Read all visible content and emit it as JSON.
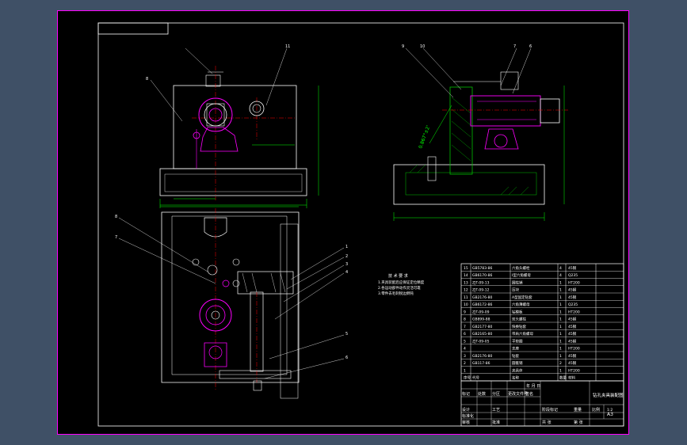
{
  "colors": {
    "viewport": "#3f5066",
    "sheet": "#000000",
    "frame": "#ff00ff",
    "line": "#ffffff",
    "outline": "#00ff00",
    "section": "#ff00ff",
    "dimension": "#00ff00",
    "center": "#ff0000",
    "hatch": "#00c000",
    "table": "#ffffff",
    "leader": "#ffffff"
  },
  "drawing": {
    "balloons_front": [
      "8",
      "11"
    ],
    "balloons_side": [
      "9",
      "10",
      "7",
      "6"
    ],
    "balloons_plan": [
      "8",
      "7",
      "1",
      "2",
      "3",
      "4",
      "5",
      "6"
    ],
    "angle_note": "0.867°±2'",
    "tech_notes": [
      "技 术 要 求",
      "1.夹具装配后应保证定位精度",
      "2.各运动部件动作灵活可靠",
      "3.零件去毛刺锐边倒钝"
    ]
  },
  "bom": {
    "rows": [
      {
        "no": "15",
        "code": "GB5783-86",
        "name": "六角头螺栓",
        "qty": "4",
        "mat": "45钢"
      },
      {
        "no": "14",
        "code": "GB6170-86",
        "name": "I型六角螺母",
        "qty": "4",
        "mat": "Q235"
      },
      {
        "no": "13",
        "code": "ZJT-09-13",
        "name": "圆柱销",
        "qty": "1",
        "mat": "HT200"
      },
      {
        "no": "12",
        "code": "ZJT-09-12",
        "name": "压块",
        "qty": "1",
        "mat": "45钢"
      },
      {
        "no": "11",
        "code": "GB2176-80",
        "name": "A型固定钻套",
        "qty": "1",
        "mat": "45钢"
      },
      {
        "no": "10",
        "code": "GB6172-86",
        "name": "六角薄螺母",
        "qty": "1",
        "mat": "Q235"
      },
      {
        "no": "9",
        "code": "ZJT-09-09",
        "name": "钻模板",
        "qty": "1",
        "mat": "HT200"
      },
      {
        "no": "8",
        "code": "GB899-88",
        "name": "双头螺柱",
        "qty": "1",
        "mat": "45钢"
      },
      {
        "no": "7",
        "code": "GB2177-80",
        "name": "快换钻套",
        "qty": "1",
        "mat": "45钢"
      },
      {
        "no": "6",
        "code": "GB2165-80",
        "name": "带肩六角螺母",
        "qty": "1",
        "mat": "45钢"
      },
      {
        "no": "5",
        "code": "ZJT-09-05",
        "name": "平垫圈",
        "qty": "1",
        "mat": "45钢"
      },
      {
        "no": "4",
        "code": "",
        "name": "支座",
        "qty": "1",
        "mat": "HT200"
      },
      {
        "no": "3",
        "code": "GB2176-80",
        "name": "钻套",
        "qty": "1",
        "mat": "45钢"
      },
      {
        "no": "2",
        "code": "GB117-86",
        "name": "圆锥销",
        "qty": "2",
        "mat": "45钢"
      },
      {
        "no": "1",
        "code": "",
        "name": "夹具体",
        "qty": "1",
        "mat": "HT200"
      }
    ],
    "header": {
      "no": "序号",
      "code": "代号",
      "name": "名称",
      "qty": "数量",
      "mat": "材料"
    }
  },
  "title_block": {
    "title": "钻孔夹具装配图",
    "cells": [
      "标记",
      "处数",
      "分区",
      "更改文件号",
      "签名",
      "年 月 日",
      "设计",
      "标准化",
      "审核",
      "工艺",
      "批准",
      "阶段标记",
      "重量",
      "比例",
      "共 张",
      "第 张"
    ],
    "scale": "1:2",
    "sheet_code": "A3"
  }
}
